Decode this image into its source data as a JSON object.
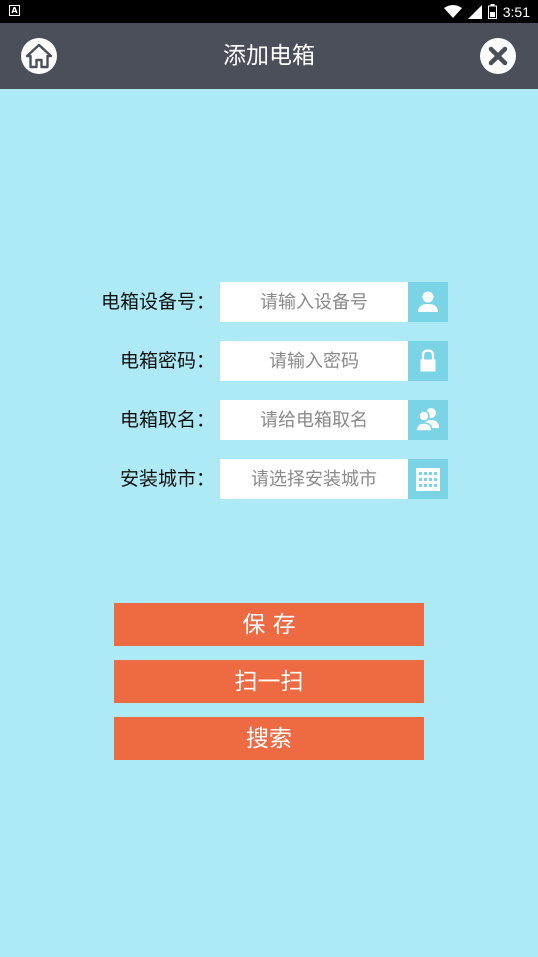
{
  "status_bar": {
    "time": "3:51",
    "icons": [
      "app-notification-icon",
      "wifi-icon",
      "signal-icon",
      "battery-icon"
    ]
  },
  "header": {
    "title": "添加电箱",
    "home_icon": "home-icon",
    "close_icon": "close-icon"
  },
  "form": {
    "device_no": {
      "label": "电箱设备号：",
      "placeholder": "请输入设备号",
      "value": "",
      "icon": "user-icon"
    },
    "password": {
      "label": "电箱密码：",
      "placeholder": "请输入密码",
      "value": "",
      "icon": "lock-icon"
    },
    "name": {
      "label": "电箱取名：",
      "placeholder": "请给电箱取名",
      "value": "",
      "icon": "users-icon"
    },
    "city": {
      "label": "安装城市：",
      "placeholder": "请选择安装城市",
      "value": "",
      "icon": "building-icon"
    }
  },
  "buttons": {
    "save": "保 存",
    "scan": "扫一扫",
    "search": "搜索"
  },
  "colors": {
    "background": "#aeeaf5",
    "header": "#4a4f5a",
    "button": "#ee6a42",
    "icon_box": "#7bd3e6"
  }
}
